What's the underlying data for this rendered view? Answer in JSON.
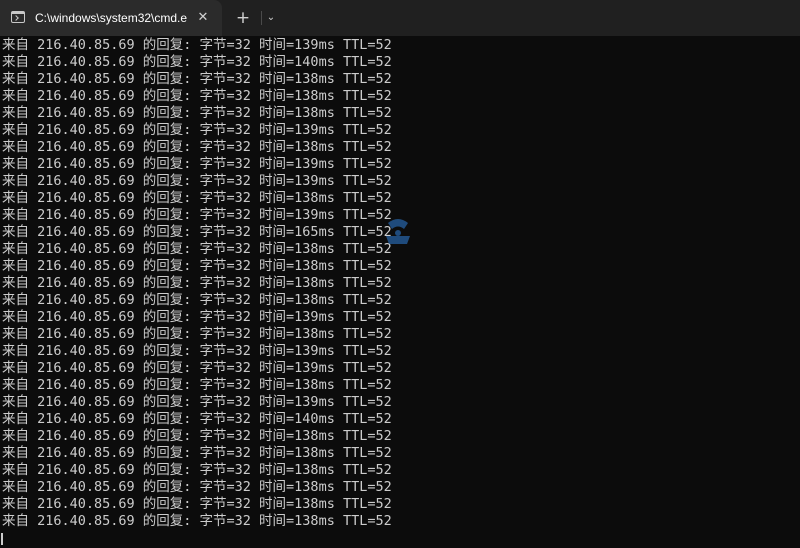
{
  "tab": {
    "icon": "terminal-icon",
    "title": "C:\\windows\\system32\\cmd.exe",
    "close_glyph": "✕"
  },
  "toolbar": {
    "new_tab_glyph": "+",
    "dropdown_glyph": "⌄"
  },
  "console": {
    "lines": [
      "来自 216.40.85.69 的回复: 字节=32 时间=139ms TTL=52",
      "来自 216.40.85.69 的回复: 字节=32 时间=140ms TTL=52",
      "来自 216.40.85.69 的回复: 字节=32 时间=138ms TTL=52",
      "来自 216.40.85.69 的回复: 字节=32 时间=138ms TTL=52",
      "来自 216.40.85.69 的回复: 字节=32 时间=138ms TTL=52",
      "来自 216.40.85.69 的回复: 字节=32 时间=139ms TTL=52",
      "来自 216.40.85.69 的回复: 字节=32 时间=138ms TTL=52",
      "来自 216.40.85.69 的回复: 字节=32 时间=139ms TTL=52",
      "来自 216.40.85.69 的回复: 字节=32 时间=139ms TTL=52",
      "来自 216.40.85.69 的回复: 字节=32 时间=138ms TTL=52",
      "来自 216.40.85.69 的回复: 字节=32 时间=139ms TTL=52",
      "来自 216.40.85.69 的回复: 字节=32 时间=165ms TTL=52",
      "来自 216.40.85.69 的回复: 字节=32 时间=138ms TTL=52",
      "来自 216.40.85.69 的回复: 字节=32 时间=138ms TTL=52",
      "来自 216.40.85.69 的回复: 字节=32 时间=138ms TTL=52",
      "来自 216.40.85.69 的回复: 字节=32 时间=138ms TTL=52",
      "来自 216.40.85.69 的回复: 字节=32 时间=139ms TTL=52",
      "来自 216.40.85.69 的回复: 字节=32 时间=138ms TTL=52",
      "来自 216.40.85.69 的回复: 字节=32 时间=139ms TTL=52",
      "来自 216.40.85.69 的回复: 字节=32 时间=139ms TTL=52",
      "来自 216.40.85.69 的回复: 字节=32 时间=138ms TTL=52",
      "来自 216.40.85.69 的回复: 字节=32 时间=139ms TTL=52",
      "来自 216.40.85.69 的回复: 字节=32 时间=140ms TTL=52",
      "来自 216.40.85.69 的回复: 字节=32 时间=138ms TTL=52",
      "来自 216.40.85.69 的回复: 字节=32 时间=138ms TTL=52",
      "来自 216.40.85.69 的回复: 字节=32 时间=138ms TTL=52",
      "来自 216.40.85.69 的回复: 字节=32 时间=138ms TTL=52",
      "来自 216.40.85.69 的回复: 字节=32 时间=138ms TTL=52",
      "来自 216.40.85.69 的回复: 字节=32 时间=138ms TTL=52"
    ],
    "text_color": "#cccccc",
    "background": "#0c0c0c"
  },
  "watermark": {
    "icon": "watermark-logo-icon",
    "color": "#2f7fd8"
  }
}
